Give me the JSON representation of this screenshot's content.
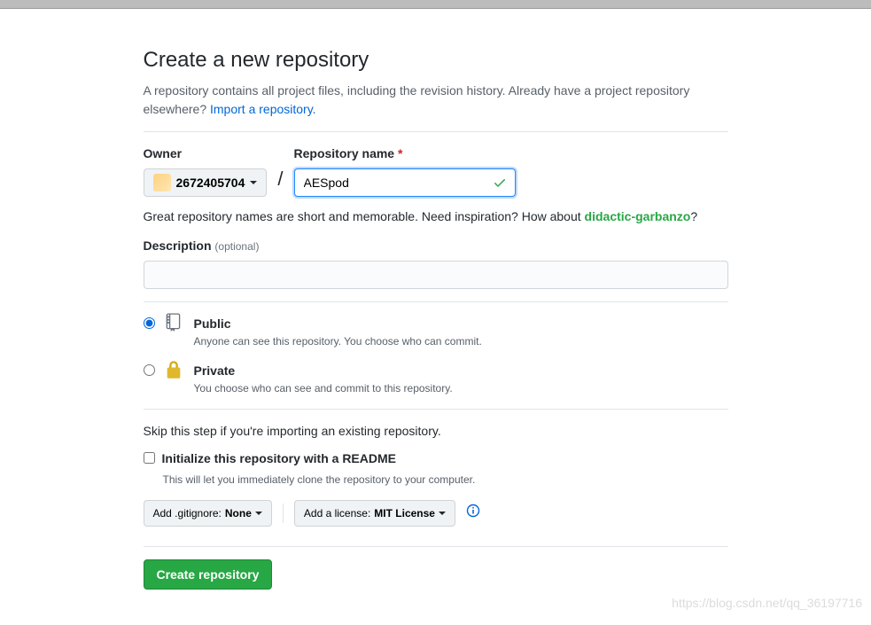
{
  "header": {
    "title": "Create a new repository",
    "subtitle_before": "A repository contains all project files, including the revision history. Already have a project repository elsewhere? ",
    "import_link": "Import a repository."
  },
  "owner_section": {
    "label": "Owner",
    "selected": "2672405704"
  },
  "slash": "/",
  "repo_name_section": {
    "label": "Repository name",
    "value": "AESpod"
  },
  "hint": {
    "before": "Great repository names are short and memorable. Need inspiration? How about ",
    "suggestion": "didactic-garbanzo",
    "after": "?"
  },
  "description_section": {
    "label": "Description",
    "optional": "(optional)",
    "value": ""
  },
  "visibility": {
    "public": {
      "title": "Public",
      "desc": "Anyone can see this repository. You choose who can commit.",
      "selected": true
    },
    "private": {
      "title": "Private",
      "desc": "You choose who can see and commit to this repository.",
      "selected": false
    }
  },
  "readme": {
    "skip_note": "Skip this step if you're importing an existing repository.",
    "init_label": "Initialize this repository with a README",
    "init_desc": "This will let you immediately clone the repository to your computer.",
    "checked": false
  },
  "dropdowns": {
    "gitignore_prefix": "Add .gitignore: ",
    "gitignore_value": "None",
    "license_prefix": "Add a license: ",
    "license_value": "MIT License"
  },
  "submit": {
    "label": "Create repository"
  },
  "watermark": "https://blog.csdn.net/qq_36197716"
}
